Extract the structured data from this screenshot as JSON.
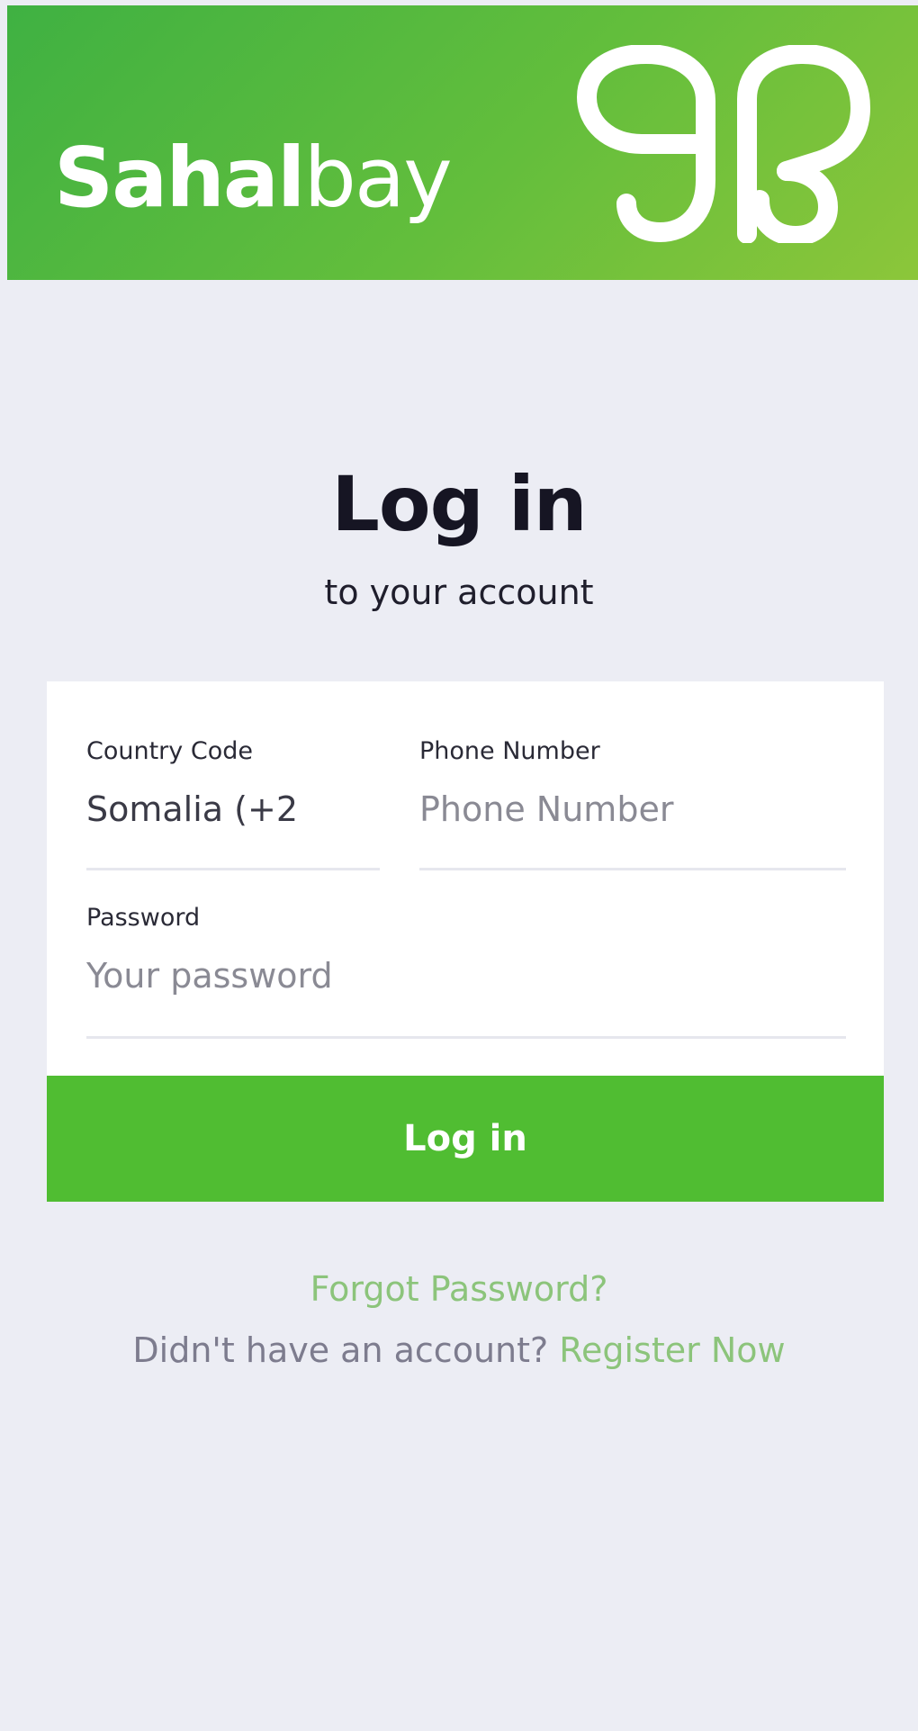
{
  "header": {
    "brand_bold": "Sahal",
    "brand_light": "bay",
    "logo_icon": "sahalbay-sb-monogram-icon",
    "gradient_start": "#3FB142",
    "gradient_end": "#8CC63A"
  },
  "login": {
    "title": "Log in",
    "subtitle": "to your account",
    "country_code": {
      "label": "Country Code",
      "value": "Somalia (+2"
    },
    "phone_number": {
      "label": "Phone Number",
      "placeholder": "Phone Number"
    },
    "password": {
      "label": "Password",
      "placeholder": "Your password"
    },
    "submit_label": "Log in",
    "forgot_password": "Forgot Password?",
    "no_account_text": "Didn't have an account?",
    "register_label": "Register Now"
  },
  "colors": {
    "background": "#ECEDF4",
    "accent_green": "#50BD32",
    "link_green": "#8CC47B"
  }
}
